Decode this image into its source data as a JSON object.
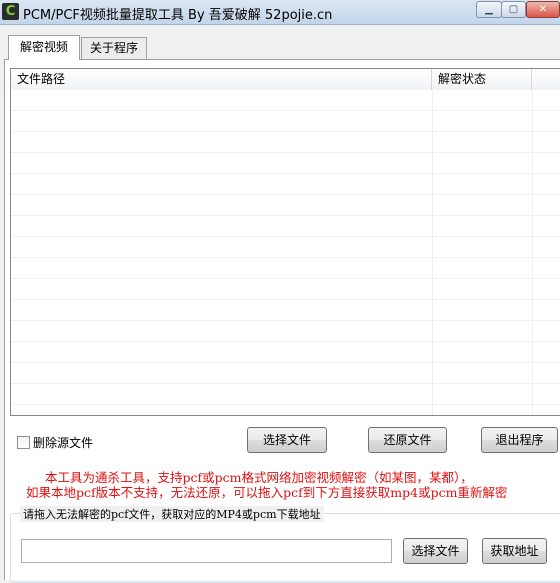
{
  "window": {
    "title": "PCM/PCF视频批量提取工具 By 吾爱破解 52pojie.cn",
    "icon_glyph": "C"
  },
  "tabs": [
    {
      "label": "解密视频",
      "active": true
    },
    {
      "label": "关于程序",
      "active": false
    }
  ],
  "list": {
    "columns": [
      "文件路径",
      "解密状态",
      ""
    ],
    "rows": []
  },
  "options": {
    "delete_source_label": "删除源文件",
    "delete_source_checked": false
  },
  "buttons": {
    "select_files": "选择文件",
    "restore_files": "还原文件",
    "exit": "退出程序",
    "select_file_2": "选择文件",
    "fetch_url": "获取地址"
  },
  "notice": {
    "line1": "本工具为通杀工具，支持pcf或pcm格式网络加密视频解密（如某图，某都），",
    "line2": "如果本地pcf版本不支持，无法还原，可以拖入pcf到下方直接获取mp4或pcm重新解密",
    "color": "#e01010"
  },
  "drop_group": {
    "label": "请拖入无法解密的pcf文件，获取对应的MP4或pcm下载地址",
    "input_value": "",
    "input_placeholder": ""
  }
}
